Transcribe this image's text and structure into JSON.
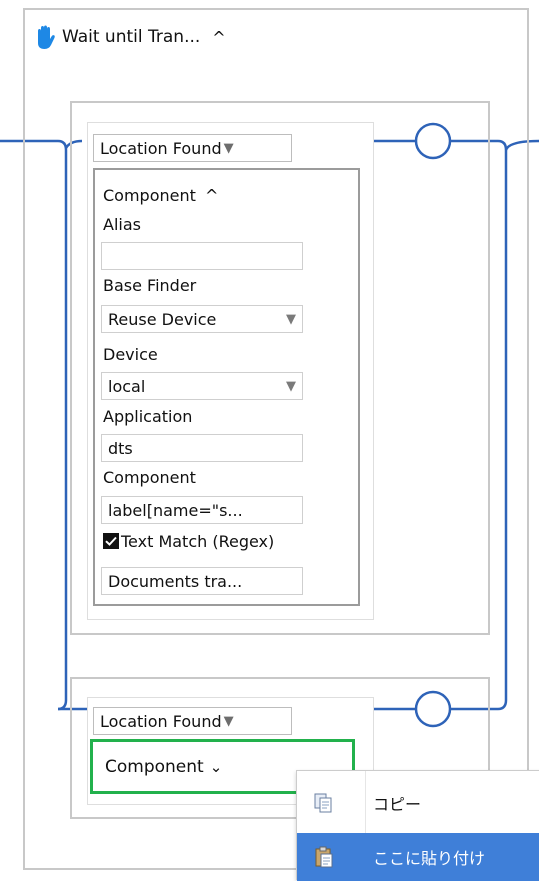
{
  "workflow": {
    "step_title": "Wait until Tran...",
    "collapse_caret": "^"
  },
  "card1": {
    "dropdown_label": "Location Found",
    "dropdown_arrow": "▼",
    "component_header": "Component",
    "component_caret": "^",
    "fields": {
      "alias_label": "Alias",
      "alias_value": "",
      "base_finder_label": "Base Finder",
      "base_finder_value": "Reuse Device",
      "device_label": "Device",
      "device_value": "local",
      "application_label": "Application",
      "application_value": "dts",
      "component_label": "Component",
      "component_value": "label[name=\"s...",
      "text_match_label": "Text Match (Regex)",
      "text_match_checked": true,
      "text_value": "Documents tra..."
    }
  },
  "card2": {
    "dropdown_label": "Location Found",
    "dropdown_arrow": "▼",
    "component_header": "Component",
    "component_caret": "⌄"
  },
  "context_menu": {
    "items": [
      {
        "label": "コピー",
        "icon": "copy-icon"
      },
      {
        "label": "ここに貼り付け",
        "icon": "paste-icon",
        "highlighted": true
      }
    ]
  },
  "colors": {
    "connector_blue": "#2e63b8",
    "selected_green": "#22b14c",
    "menu_highlight": "#3f7fd8"
  }
}
